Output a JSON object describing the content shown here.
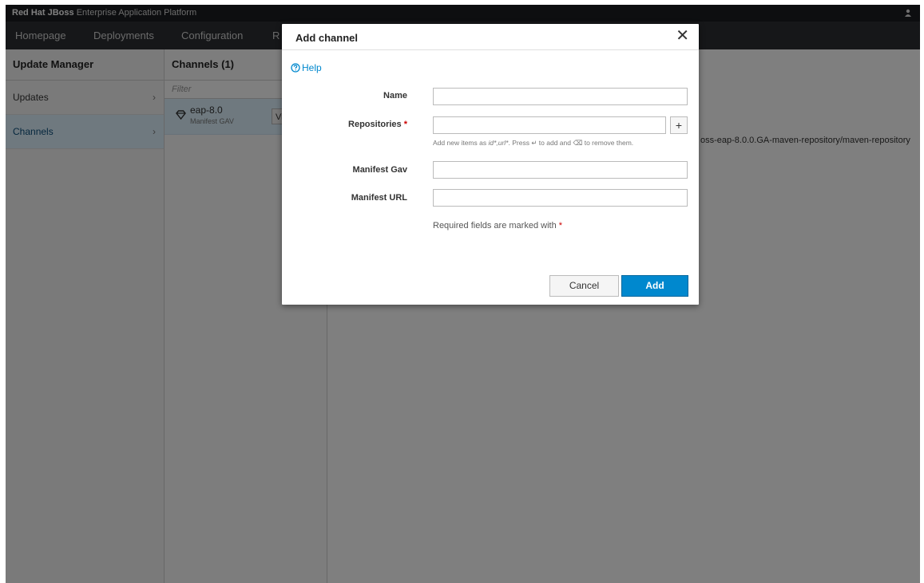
{
  "masthead": {
    "brand_strong": "Red Hat JBoss",
    "brand_rest": " Enterprise Application Platform"
  },
  "nav": {
    "items": [
      "Homepage",
      "Deployments",
      "Configuration",
      "R"
    ]
  },
  "left_column": {
    "title": "Update Manager",
    "items": [
      {
        "label": "Updates",
        "chevron": "›"
      },
      {
        "label": "Channels",
        "chevron": "›"
      }
    ]
  },
  "middle_column": {
    "title": "Channels (1)",
    "filter_placeholder": "Filter",
    "channel": {
      "name": "eap-8.0",
      "subtitle": "Manifest GAV",
      "view_label": "Vi"
    }
  },
  "right_column": {
    "repository_text": "oss-eap-8.0.0.GA-maven-repository/maven-repository"
  },
  "modal": {
    "title": "Add channel",
    "close_glyph": "✕",
    "help_label": "Help",
    "fields": {
      "name_label": "Name",
      "name_value": "",
      "repositories_label": "Repositories",
      "repositories_value": "",
      "required_marker": "*",
      "plus_glyph": "+",
      "manifest_gav_label": "Manifest Gav",
      "manifest_gav_value": "",
      "manifest_url_label": "Manifest URL",
      "manifest_url_value": ""
    },
    "hint": {
      "prefix": "Add new items as ",
      "format": "id*,url*",
      "middle": ". Press ",
      "enter_glyph": "↵",
      "after_enter": " to add and ",
      "backspace_glyph": "⌫",
      "suffix": " to remove them."
    },
    "required_note": "Required fields are marked with",
    "cancel_label": "Cancel",
    "add_label": "Add"
  },
  "colors": {
    "primary": "#0088ce",
    "masthead": "#1b1d21",
    "nav": "#2c2f33",
    "selected": "#def3ff",
    "required": "#cc0000"
  }
}
